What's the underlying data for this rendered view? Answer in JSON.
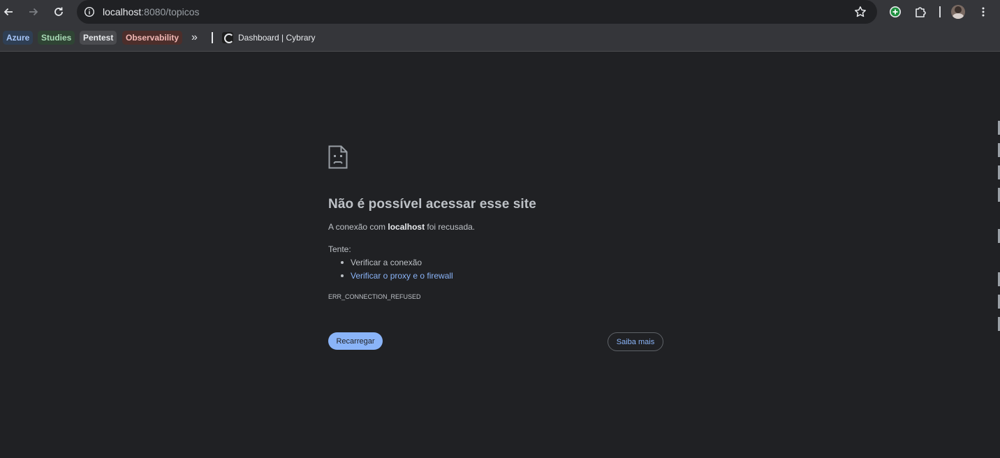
{
  "browser": {
    "url_host": "localhost",
    "url_rest": ":8080/topicos"
  },
  "bookmarks": {
    "folders": [
      {
        "label": "Azure",
        "bg": "#2f3f54",
        "fg": "#a8c7fa"
      },
      {
        "label": "Studies",
        "bg": "#2f4434",
        "fg": "#a8dab5"
      },
      {
        "label": "Pentest",
        "bg": "#4a4b4f",
        "fg": "#e8eaed"
      },
      {
        "label": "Observability",
        "bg": "#4c2e2b",
        "fg": "#f2b8b5"
      }
    ],
    "link_title": "Dashboard | Cybrary"
  },
  "error": {
    "headline": "Não é possível acessar esse site",
    "desc_before": "A conexão com ",
    "desc_host": "localhost",
    "desc_after": " foi recusada.",
    "try_label": "Tente:",
    "suggestions": [
      {
        "text": "Verificar a conexão"
      },
      {
        "text": "Verificar o proxy e o firewall"
      }
    ],
    "code": "ERR_CONNECTION_REFUSED",
    "reload_label": "Recarregar",
    "learn_more_label": "Saiba mais"
  },
  "colors": {
    "background": "#202124",
    "toolbar": "#35363a",
    "accent": "#8ab4f8"
  }
}
